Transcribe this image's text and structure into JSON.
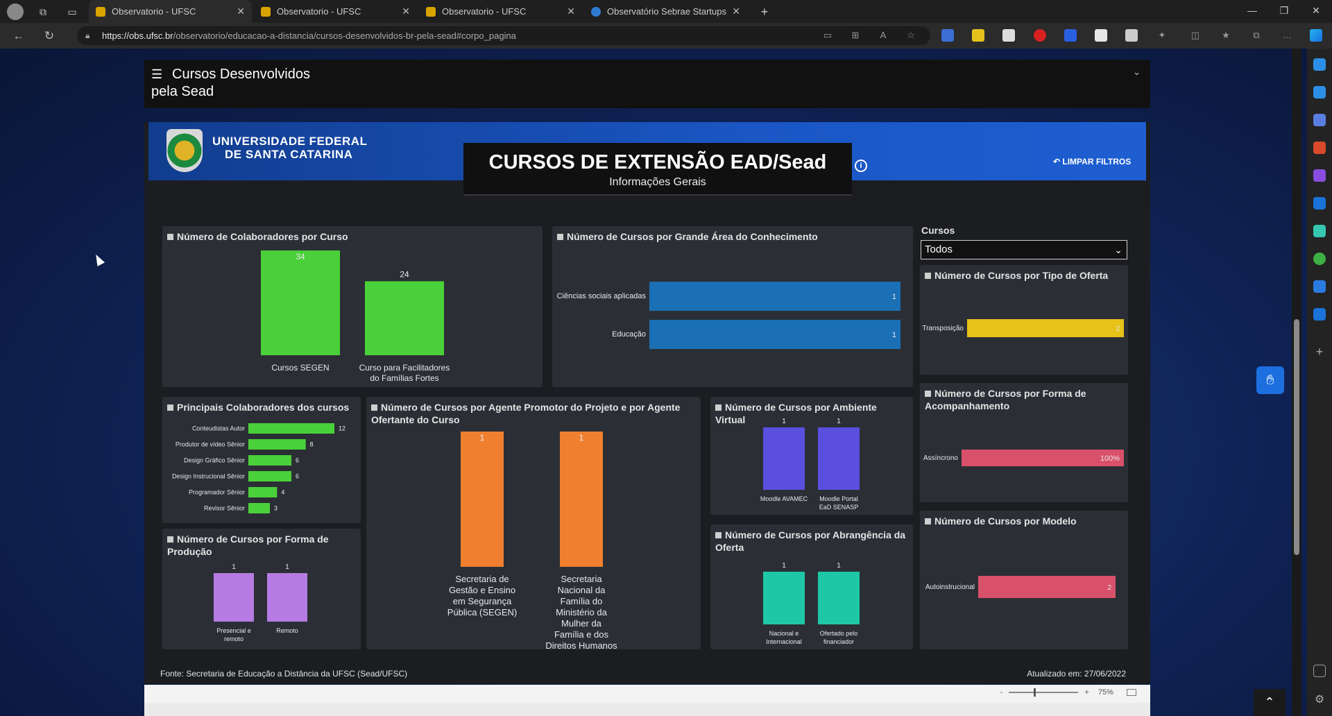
{
  "browser": {
    "tabs": [
      {
        "title": "Observatorio - UFSC",
        "active": true
      },
      {
        "title": "Observatorio - UFSC",
        "active": false
      },
      {
        "title": "Observatorio - UFSC",
        "active": false
      },
      {
        "title": "Observatório Sebrae Startups",
        "active": false
      }
    ],
    "url_host": "https://obs.ufsc.br",
    "url_path": "/observatorio/educacao-a-distancia/cursos-desenvolvidos-br-pela-sead#corpo_pagina",
    "icons": [
      "profile-icon",
      "workspaces-icon",
      "tab-actions-icon",
      "back-icon",
      "refresh-icon",
      "lock-icon",
      "read-aloud-icon",
      "favorite-icon",
      "extensions-icon",
      "split-screen-icon",
      "favorites-icon",
      "collections-icon",
      "more-icon",
      "copilot-icon"
    ]
  },
  "pbi": {
    "header_title_line1": "Cursos Desenvolvidos",
    "header_title_line2": "pela Sead",
    "zoom": "75%",
    "zoom_minus": "-",
    "zoom_plus": "+"
  },
  "report": {
    "university_line1": "UNIVERSIDADE FEDERAL",
    "university_line2": "DE SANTA CATARINA",
    "title": "CURSOS DE EXTENSÃO EAD/Sead",
    "subtitle": "Informações Gerais",
    "clear_filters": "LIMPAR FILTROS",
    "slicer_label": "Cursos",
    "slicer_value": "Todos",
    "source": "Fonte: Secretaria de Educação a Distância da UFSC (Sead/UFSC)",
    "updated": "Atualizado em: 27/06/2022"
  },
  "colors": {
    "green": "#4ad139",
    "blue": "#1b6fb5",
    "orange": "#f08030",
    "purple_ambiente": "#5b4fe0",
    "lilac": "#b57be3",
    "teal": "#1ec7a5",
    "yellow": "#e7c21a",
    "pink": "#d9506a"
  },
  "chart_data": [
    {
      "id": "colab_curso",
      "type": "bar",
      "title": "Número de Colaboradores por Curso",
      "categories": [
        "Cursos SEGEN",
        "Curso para Facilitadores do Famílias Fortes"
      ],
      "values": [
        34,
        24
      ],
      "ylim": [
        0,
        34
      ]
    },
    {
      "id": "grande_area",
      "type": "bar",
      "orientation": "horizontal",
      "title": "Número de Cursos por Grande Área do Conhecimento",
      "categories": [
        "Ciências sociais aplicadas",
        "Educação"
      ],
      "values": [
        1,
        1
      ],
      "xlim": [
        0,
        1
      ]
    },
    {
      "id": "tipo_oferta",
      "type": "bar",
      "orientation": "horizontal",
      "title": "Número de Cursos por Tipo de Oferta",
      "categories": [
        "Transposição"
      ],
      "values": [
        2
      ],
      "xlim": [
        0,
        2
      ]
    },
    {
      "id": "principais_colab",
      "type": "bar",
      "orientation": "horizontal",
      "title": "Principais Colaboradores dos cursos",
      "categories": [
        "Conteudistas Autor",
        "Produtor de vídeo Sênior",
        "Design Gráfico Sênior",
        "Design Instrucional Sênior",
        "Programador Sênior",
        "Revisor Sênior"
      ],
      "values": [
        12,
        8,
        6,
        6,
        4,
        3
      ],
      "xlim": [
        0,
        12
      ]
    },
    {
      "id": "agente",
      "type": "bar",
      "title": "Número de Cursos por Agente Promotor do Projeto e por Agente Ofertante do Curso",
      "categories": [
        "Secretaria de Gestão e Ensino em Segurança Pública (SEGEN)",
        "Secretaria Nacional da Família do Ministério da Mulher da Família e dos Direitos Humanos (MMFDH)"
      ],
      "values": [
        1,
        1
      ],
      "ylim": [
        0,
        1
      ]
    },
    {
      "id": "ambiente",
      "type": "bar",
      "title": "Número de Cursos por Ambiente Virtual",
      "categories": [
        "Moodle AVAMEC",
        "Moodle Portal EaD SENASP"
      ],
      "values": [
        1,
        1
      ],
      "ylim": [
        0,
        1
      ]
    },
    {
      "id": "acompanhamento",
      "type": "bar",
      "orientation": "horizontal",
      "title": "Número de Cursos por Forma de Acompanhamento",
      "categories": [
        "Assíncrono"
      ],
      "values": [
        100
      ],
      "value_labels": [
        "100%"
      ],
      "xlim": [
        0,
        100
      ]
    },
    {
      "id": "producao",
      "type": "bar",
      "title": "Número de Cursos por Forma de Produção",
      "categories": [
        "Presencial e remoto",
        "Remoto"
      ],
      "values": [
        1,
        1
      ],
      "ylim": [
        0,
        1
      ]
    },
    {
      "id": "abrangencia",
      "type": "bar",
      "title": "Número de Cursos por Abrangência da Oferta",
      "categories": [
        "Nacional e Internacional",
        "Ofertado pelo financiador"
      ],
      "values": [
        1,
        1
      ],
      "ylim": [
        0,
        1
      ]
    },
    {
      "id": "modelo",
      "type": "bar",
      "orientation": "horizontal",
      "title": "Número de Cursos por Modelo",
      "categories": [
        "Autoinstrucional"
      ],
      "values": [
        2
      ],
      "xlim": [
        0,
        2
      ]
    }
  ]
}
